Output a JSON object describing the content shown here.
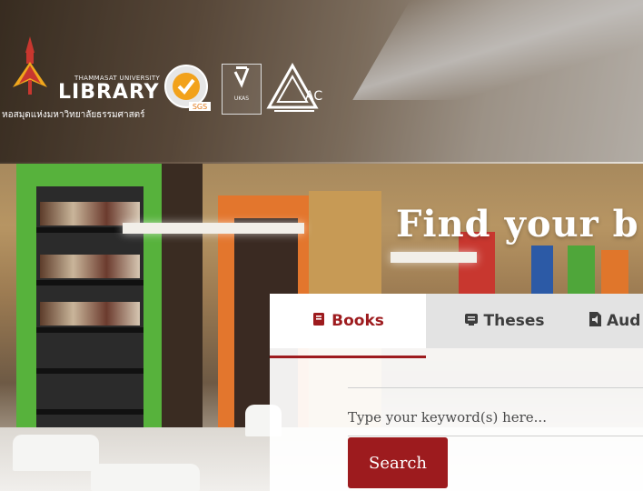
{
  "header": {
    "university_text": "THAMMASAT UNIVERSITY",
    "library_text": "LIBRARY",
    "thai_name": "หอสมุดแห่งมหาวิทยาลัยธรรมศาสตร์",
    "logos": [
      "tu-library-logo",
      "sgs-certification-badge",
      "ukas-badge",
      "nac-badge"
    ],
    "ukas_text": "UKAS"
  },
  "hero": {
    "headline": "Find your b"
  },
  "search": {
    "tabs": [
      {
        "label": "Books",
        "icon": "book-icon"
      },
      {
        "label": "Theses",
        "icon": "thesis-icon"
      },
      {
        "label": "Aud",
        "icon": "audio-file-icon"
      }
    ],
    "active_tab": "Books",
    "placeholder": "Type your keyword(s) here...",
    "button_label": "Search"
  },
  "colors": {
    "accent": "#9d1b1e",
    "tab_bar": "#e2e2e2",
    "panel": "#ffffff"
  }
}
